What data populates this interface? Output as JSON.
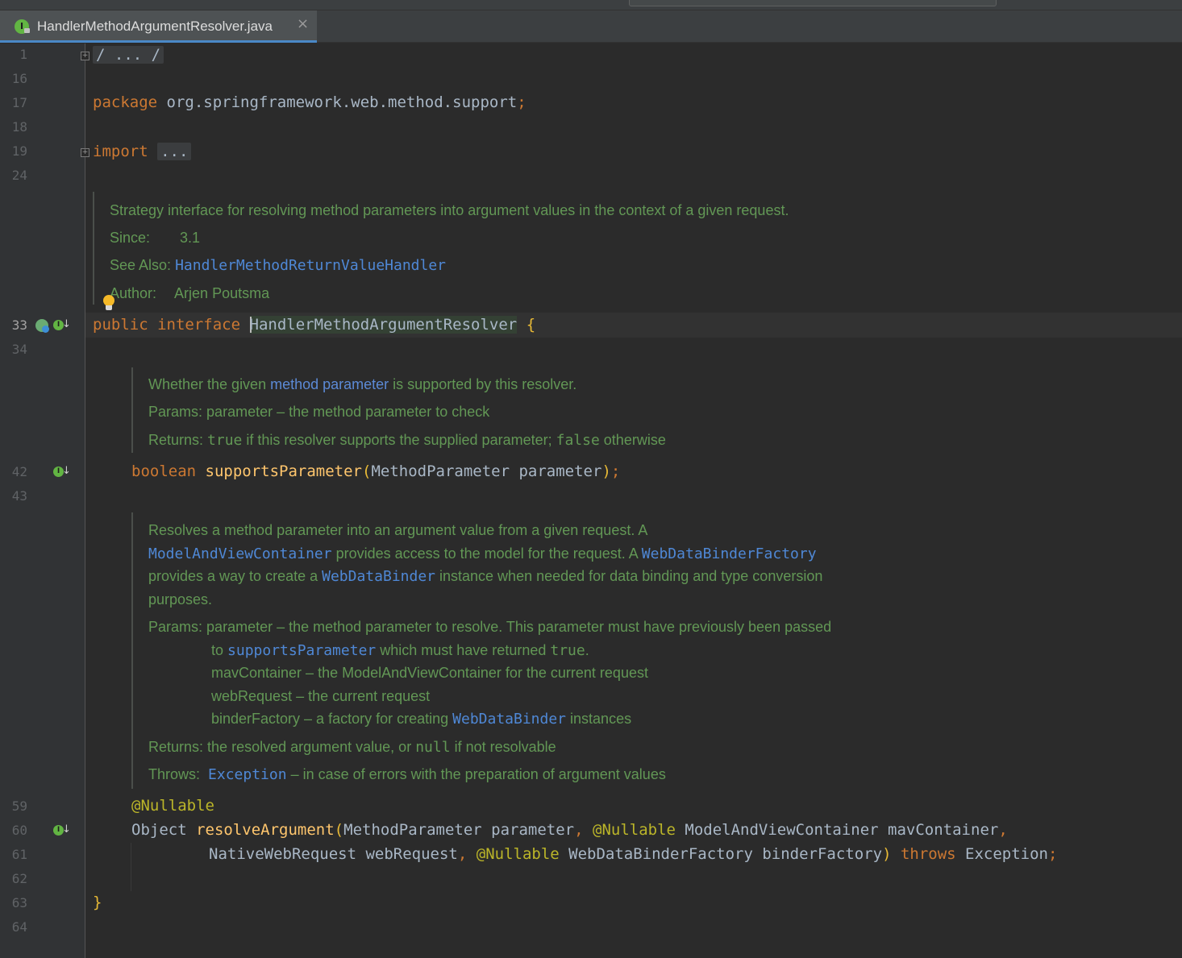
{
  "tab": {
    "title": "HandlerMethodArgumentResolver.java",
    "icon_letter": "I",
    "close": "×"
  },
  "line_numbers": [
    "1",
    "16",
    "17",
    "18",
    "19",
    "24",
    "33",
    "34",
    "42",
    "43",
    "59",
    "60",
    "61",
    "62",
    "63",
    "64"
  ],
  "code": {
    "l1_fold": "/ ... /",
    "l17_kw": "package",
    "l17_rest": " org.springframework.web.method.support",
    "l17_semi": ";",
    "l19_kw": "import",
    "l19_fold": "...",
    "l33_public": "public",
    "l33_interface": "interface",
    "l33_name": "HandlerMethodArgumentResolver",
    "l33_brace": "{",
    "l42_type": "boolean",
    "l42_fn": "supportsParameter",
    "l42_open": "(",
    "l42_params": "MethodParameter parameter",
    "l42_close": ")",
    "l42_semi": ";",
    "l59_ann": "@Nullable",
    "l60_type": "Object ",
    "l60_fn": "resolveArgument",
    "l60_open": "(",
    "l60_p1": "MethodParameter parameter",
    "l60_comma1": ", ",
    "l60_ann": "@Nullable",
    "l60_p2": " ModelAndViewContainer mavContainer",
    "l60_comma2": ",",
    "l61_p3": "NativeWebRequest webRequest",
    "l61_comma": ", ",
    "l61_ann": "@Nullable",
    "l61_p4": " WebDataBinderFactory binderFactory",
    "l61_close": ")",
    "l61_throws": " throws",
    "l61_exc": " Exception",
    "l61_semi": ";",
    "l63_brace": "}"
  },
  "doc_interface": {
    "summary": "Strategy interface for resolving method parameters into argument values in the context of a given request.",
    "since_label": "Since:",
    "since_value": "3.1",
    "see_label": "See Also:",
    "see_value": "HandlerMethodReturnValueHandler",
    "author_label": "Author:",
    "author_value": "Arjen Poutsma"
  },
  "doc_supports": {
    "s1": "Whether the given ",
    "s_link": "method parameter",
    "s2": " is supported by this resolver.",
    "params_label": "Params:",
    "params_value": "parameter – the method parameter to check",
    "returns_label": "Returns:",
    "r_true": "true",
    "r_mid": " if this resolver supports the supplied parameter; ",
    "r_false": "false",
    "r_end": " otherwise"
  },
  "doc_resolve": {
    "l1": "Resolves a method parameter into an argument value from a given request. A",
    "l2_link1": "ModelAndViewContainer",
    "l2_mid": " provides access to the model for the request. A ",
    "l2_link2": "WebDataBinderFactory",
    "l3_a": "provides a way to create a ",
    "l3_link": "WebDataBinder",
    "l3_b": " instance when needed for data binding and type conversion",
    "l4": "purposes.",
    "params_label": "Params:",
    "p1": "parameter – the method parameter to resolve. This parameter must have previously been passed",
    "p2_a": "to ",
    "p2_link": "supportsParameter",
    "p2_b": " which must have returned ",
    "p2_true": "true",
    "p2_c": ".",
    "p3": "mavContainer – the ModelAndViewContainer for the current request",
    "p4": "webRequest – the current request",
    "p5_a": "binderFactory – a factory for creating ",
    "p5_link": "WebDataBinder",
    "p5_b": " instances",
    "returns_label": "Returns:",
    "r_a": "the resolved argument value, or ",
    "r_null": "null",
    "r_b": " if not resolvable",
    "throws_label": "Throws:",
    "t_link": "Exception",
    "t_rest": " – in case of errors with the preparation of argument values"
  }
}
